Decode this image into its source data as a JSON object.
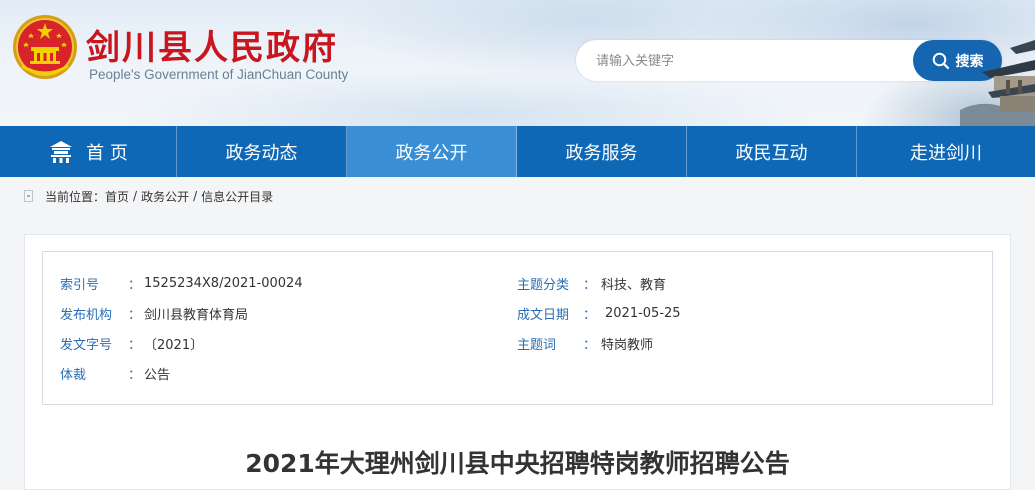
{
  "header": {
    "title": "剑川县人民政府",
    "subtitle": "People's Government of JianChuan County",
    "emblem_icon": "national-emblem-icon",
    "brand_color": "#c8161e"
  },
  "search": {
    "placeholder": "请输入关键字",
    "button_label": "搜索",
    "icon": "search-icon",
    "button_color": "#1565b0"
  },
  "nav": {
    "color": "#0f68b5",
    "active_color": "#3a8fd4",
    "home_icon": "home-icon",
    "items": [
      {
        "label": "首 页"
      },
      {
        "label": "政务动态"
      },
      {
        "label": "政务公开",
        "active": true
      },
      {
        "label": "政务服务"
      },
      {
        "label": "政民互动"
      },
      {
        "label": "走进剑川"
      }
    ]
  },
  "breadcrumb": {
    "prefix": "当前位置：",
    "items": [
      "首页",
      "政务公开",
      "信息公开目录"
    ],
    "separator": "/"
  },
  "meta": {
    "colon": "：",
    "index_label": "索引号",
    "index_value": "1525234X8/2021-00024",
    "publisher_label": "发布机构",
    "publisher_value": "剑川县教育体育局",
    "docno_label": "发文字号",
    "docno_value": "〔2021〕",
    "genre_label": "体裁",
    "genre_value": "公告",
    "topic_label": "主题分类",
    "topic_value": "科技、教育",
    "date_label": "成文日期",
    "date_value": "2021-05-25",
    "keyword_label": "主题词",
    "keyword_value": "特岗教师"
  },
  "article": {
    "title": "2021年大理州剑川县中央招聘特岗教师招聘公告"
  }
}
